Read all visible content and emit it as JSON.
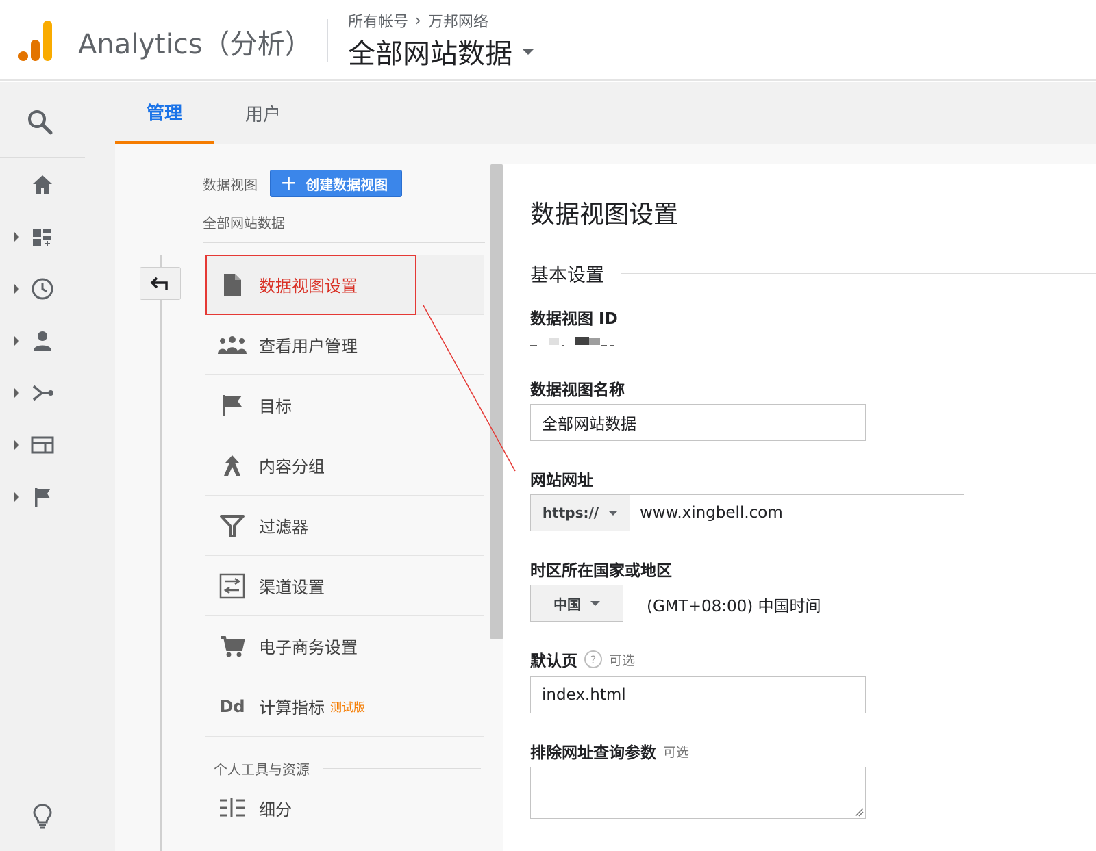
{
  "header": {
    "app_title": "Analytics（分析）",
    "breadcrumb": [
      "所有帐号",
      "万邦网络"
    ],
    "breadcrumb_sep": "›",
    "view_name": "全部网站数据"
  },
  "tabs": [
    {
      "label": "管理",
      "active": true
    },
    {
      "label": "用户",
      "active": false
    }
  ],
  "rail_icons": [
    "home-icon",
    "dashboard-icon",
    "clock-icon",
    "person-icon",
    "acquisition-icon",
    "behavior-icon",
    "flag-icon",
    "lightbulb-icon"
  ],
  "column": {
    "header_label": "数据视图",
    "create_button": "创建数据视图",
    "current_view": "全部网站数据",
    "items": [
      {
        "label": "数据视图设置",
        "icon": "document-icon",
        "active": true
      },
      {
        "label": "查看用户管理",
        "icon": "users-icon"
      },
      {
        "label": "目标",
        "icon": "flag-icon"
      },
      {
        "label": "内容分组",
        "icon": "content-grouping-icon"
      },
      {
        "label": "过滤器",
        "icon": "filter-icon"
      },
      {
        "label": "渠道设置",
        "icon": "channel-icon"
      },
      {
        "label": "电子商务设置",
        "icon": "cart-icon"
      },
      {
        "label": "计算指标",
        "icon": "dd-icon",
        "badge": "测试版"
      }
    ],
    "section_label": "个人工具与资源",
    "segments_label": "细分",
    "dd_text": "Dd"
  },
  "panel": {
    "title": "数据视图设置",
    "section": "基本设置",
    "view_id_label": "数据视图 ID",
    "view_name_label": "数据视图名称",
    "view_name_value": "全部网站数据",
    "site_url_label": "网站网址",
    "protocol": "https://",
    "site_url_value": "www.xingbell.com",
    "timezone_label": "时区所在国家或地区",
    "country": "中国",
    "timezone_value": "(GMT+08:00) 中国时间",
    "default_page_label": "默认页",
    "help_mark": "?",
    "optional": "可选",
    "default_page_value": "index.html",
    "exclude_params_label": "排除网址查询参数",
    "exclude_params_value": ""
  },
  "colors": {
    "accent_blue": "#1a73e8",
    "tab_underline": "#f57c00",
    "highlight_red": "#e53935",
    "logo_orange": "#f9ab00",
    "logo_dark_orange": "#e37400"
  }
}
